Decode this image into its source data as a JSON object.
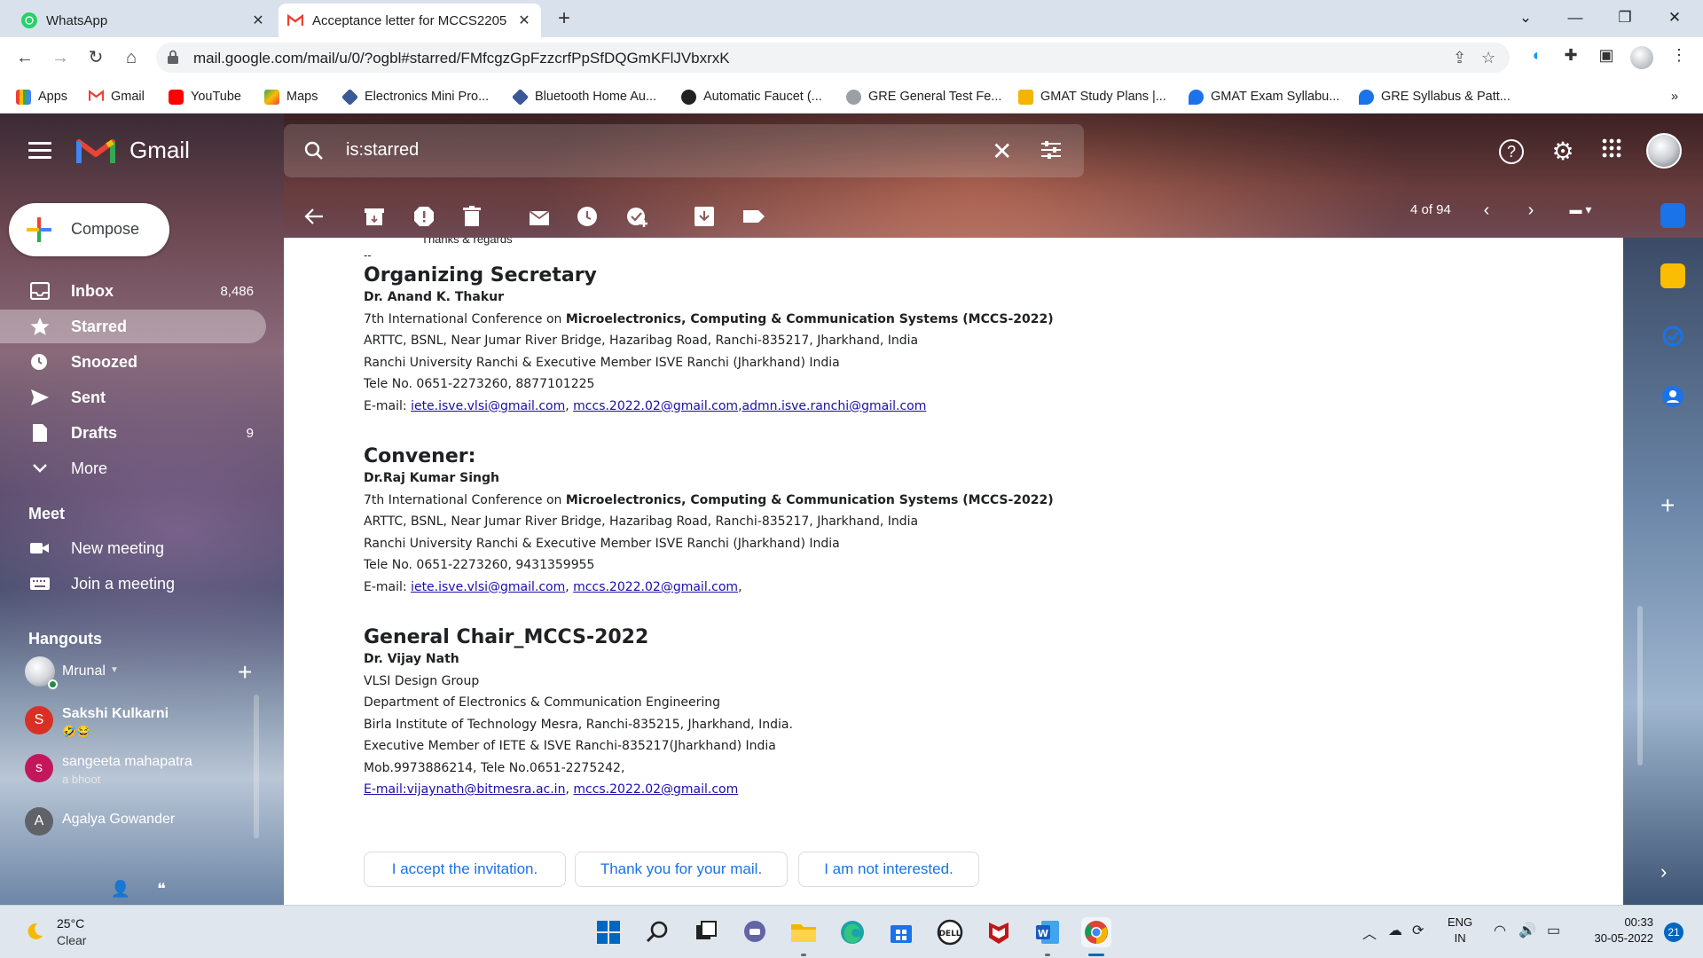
{
  "browser": {
    "tabs": [
      {
        "title": "WhatsApp",
        "close": "✕"
      },
      {
        "title": "Acceptance letter for MCCS2205",
        "close": "✕"
      }
    ],
    "new_tab": "+",
    "window_controls": {
      "minimize": "—",
      "restore": "❐",
      "close": "✕",
      "menu": "⌄"
    },
    "url": "mail.google.com/mail/u/0/?ogbl#starred/FMfcgzGpFzzcrfPpSfDQGmKFlJVbxrxK",
    "bookmarks": [
      "Apps",
      "Gmail",
      "YouTube",
      "Maps",
      "Electronics Mini Pro...",
      "Bluetooth Home Au...",
      "Automatic Faucet (...",
      "GRE General Test Fe...",
      "GMAT Study Plans |...",
      "GMAT Exam Syllabu...",
      "GRE Syllabus & Patt..."
    ],
    "bookmarks_more": "»"
  },
  "gmail": {
    "brand": "Gmail",
    "search_query": "is:starred",
    "compose_label": "Compose",
    "nav": [
      {
        "label": "Inbox",
        "count": "8,486"
      },
      {
        "label": "Starred",
        "count": ""
      },
      {
        "label": "Snoozed",
        "count": ""
      },
      {
        "label": "Sent",
        "count": ""
      },
      {
        "label": "Drafts",
        "count": "9"
      },
      {
        "label": "More",
        "count": ""
      }
    ],
    "meet_title": "Meet",
    "meet_items": [
      "New meeting",
      "Join a meeting"
    ],
    "hangouts_title": "Hangouts",
    "hangouts_user": "Mrunal",
    "contacts": [
      {
        "initial": "S",
        "name": "Sakshi Kulkarni",
        "status": "🤣😂",
        "color": "#d93025"
      },
      {
        "initial": "s",
        "name": "sangeeta mahapatra",
        "status": "a bhoot",
        "color": "#c2185b"
      },
      {
        "initial": "A",
        "name": "Agalya Gowander",
        "status": "",
        "color": "#5f6368"
      }
    ],
    "pager": "4 of 94"
  },
  "email": {
    "tail_text": "Thanks & regards",
    "dashes": "--",
    "blocks": [
      {
        "heading": "Organizing Secretary",
        "name": "Dr. Anand K. Thakur",
        "conf_prefix": "7th International Conference on ",
        "conf_bold": "Microelectronics, Computing & Communication Systems (MCCS-2022)",
        "lines": [
          "ARTTC, BSNL, Near Jumar River Bridge, Hazaribag Road, Ranchi-835217, Jharkhand, India",
          "Ranchi University Ranchi & Executive Member ISVE Ranchi (Jharkhand) India",
          "Tele No. 0651-2273260, 8877101225"
        ],
        "email_prefix": "E-mail: ",
        "emails": [
          "iete.isve.vlsi@gmail.com",
          "mccs.2022.02@gmail.com",
          "admn.isve.ranchi@gmail.com"
        ]
      },
      {
        "heading": "Convener:",
        "name": "Dr.Raj Kumar Singh",
        "conf_prefix": "7th International Conference on ",
        "conf_bold": "Microelectronics, Computing & Communication Systems (MCCS-2022)",
        "lines": [
          "ARTTC, BSNL, Near Jumar River Bridge, Hazaribag Road, Ranchi-835217, Jharkhand, India",
          "Ranchi University Ranchi & Executive Member ISVE Ranchi (Jharkhand) India",
          "Tele No. 0651-2273260, 9431359955"
        ],
        "email_prefix": "E-mail: ",
        "emails": [
          "iete.isve.vlsi@gmail.com",
          "mccs.2022.02@gmail.com"
        ]
      }
    ],
    "general_chair": {
      "heading": "General Chair_MCCS-2022",
      "name": "Dr. Vijay Nath",
      "lines": [
        "VLSI Design Group",
        "Department of Electronics & Communication Engineering",
        "Birla Institute of Technology Mesra, Ranchi-835215, Jharkhand, India.",
        "Executive Member of IETE & ISVE Ranchi-835217(Jharkhand) India",
        "Mob.9973886214, Tele No.0651-2275242,"
      ],
      "emails": [
        "E-mail:vijaynath@bitmesra.ac.in",
        "mccs.2022.02@gmail.com"
      ]
    },
    "smart_replies": [
      "I accept the invitation.",
      "Thank you for your mail.",
      "I am not interested."
    ]
  },
  "taskbar": {
    "temperature": "25°C",
    "condition": "Clear",
    "lang_top": "ENG",
    "lang_bottom": "IN",
    "time": "00:33",
    "date": "30-05-2022",
    "notifications": "21"
  }
}
